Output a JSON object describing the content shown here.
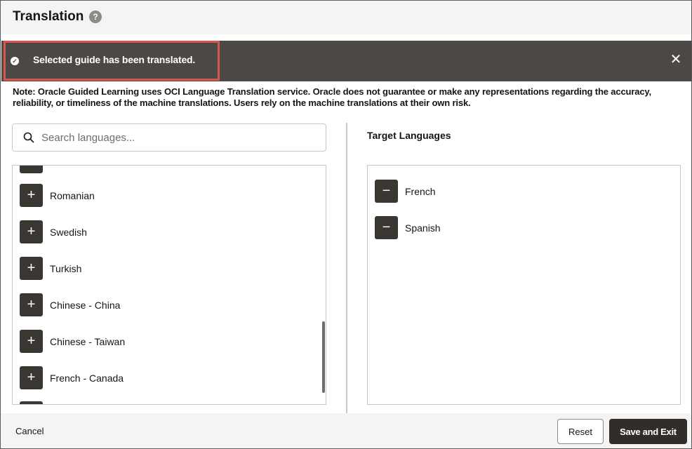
{
  "header": {
    "title": "Translation",
    "help_icon": "?"
  },
  "toast": {
    "message": "Selected guide has been translated.",
    "close_label": "✕",
    "check_icon": "✓"
  },
  "note": "Note: Oracle Guided Learning uses OCI Language Translation service. Oracle does not guarantee or make any representations regarding the accuracy, reliability, or timeliness of the machine translations. Users rely on the machine translations at their own risk.",
  "search": {
    "placeholder": "Search languages..."
  },
  "available_languages": [
    "Romanian",
    "Swedish",
    "Turkish",
    "Chinese - China",
    "Chinese - Taiwan",
    "French - Canada"
  ],
  "target": {
    "title": "Target Languages",
    "languages": [
      "French",
      "Spanish"
    ]
  },
  "icons": {
    "add": "+",
    "remove": "−"
  },
  "footer": {
    "cancel_label": "Cancel",
    "reset_label": "Reset",
    "save_label": "Save and Exit"
  },
  "colors": {
    "toast_bg": "#4c4945",
    "highlight": "#d9534f",
    "button_dark": "#3a3733",
    "primary_button": "#312d2a"
  }
}
